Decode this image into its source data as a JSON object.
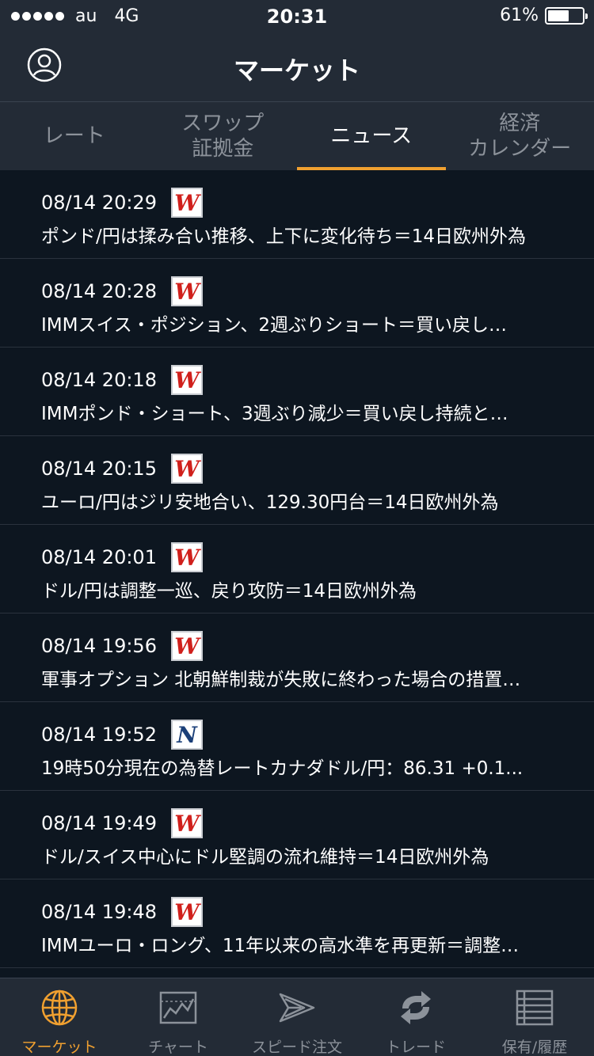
{
  "status_bar": {
    "carrier": "au",
    "network": "4G",
    "time": "20:31",
    "battery": "61%",
    "battery_level": 0.61
  },
  "nav": {
    "title": "マーケット"
  },
  "tabs": [
    {
      "label": "レート",
      "active": false
    },
    {
      "label": "スワップ\n証拠金",
      "active": false
    },
    {
      "label": "ニュース",
      "active": true
    },
    {
      "label": "経済\nカレンダー",
      "active": false
    }
  ],
  "news": [
    {
      "time": "08/14 20:29",
      "source": "W",
      "headline": "ポンド/円は揉み合い推移、上下に変化待ち＝14日欧州外為"
    },
    {
      "time": "08/14 20:28",
      "source": "W",
      "headline": "IMMスイス・ポジション、2週ぶりショート＝買い戻し…"
    },
    {
      "time": "08/14 20:18",
      "source": "W",
      "headline": "IMMポンド・ショート、3週ぶり減少＝買い戻し持続と…"
    },
    {
      "time": "08/14 20:15",
      "source": "W",
      "headline": "ユーロ/円はジリ安地合い、129.30円台＝14日欧州外為"
    },
    {
      "time": "08/14 20:01",
      "source": "W",
      "headline": "ドル/円は調整一巡、戻り攻防＝14日欧州外為"
    },
    {
      "time": "08/14 19:56",
      "source": "W",
      "headline": "軍事オプション 北朝鮮制裁が失敗に終わった場合の措置…"
    },
    {
      "time": "08/14 19:52",
      "source": "N",
      "headline": "19時50分現在の為替レートカナダドル/円：86.31 +0.1..."
    },
    {
      "time": "08/14 19:49",
      "source": "W",
      "headline": "ドル/スイス中心にドル堅調の流れ維持＝14日欧州外為"
    },
    {
      "time": "08/14 19:48",
      "source": "W",
      "headline": "IMMユーロ・ロング、11年以来の高水準を再更新＝調整…"
    }
  ],
  "tab_bar": [
    {
      "label": "マーケット",
      "icon": "globe-icon",
      "active": true
    },
    {
      "label": "チャート",
      "icon": "chart-icon",
      "active": false
    },
    {
      "label": "スピード注文",
      "icon": "speed-arrow-icon",
      "active": false
    },
    {
      "label": "トレード",
      "icon": "refresh-arrows-icon",
      "active": false
    },
    {
      "label": "保有/履歴",
      "icon": "list-icon",
      "active": false
    }
  ],
  "colors": {
    "accent": "#f0a030",
    "background": "#0d1620",
    "bar": "#232b36",
    "inactive": "#8c929a"
  }
}
